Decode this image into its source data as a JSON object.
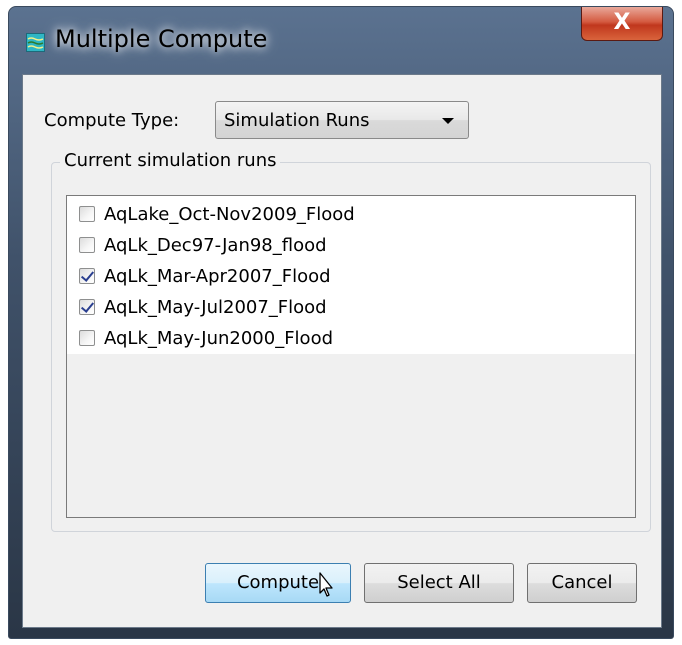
{
  "window": {
    "title": "Multiple Compute",
    "app_icon": "map-icon",
    "close_glyph": "X"
  },
  "compute_type": {
    "label": "Compute Type:",
    "selected": "Simulation Runs"
  },
  "runs_group": {
    "label": "Current simulation runs",
    "items": [
      {
        "label": "AqLake_Oct-Nov2009_Flood",
        "checked": false
      },
      {
        "label": "AqLk_Dec97-Jan98_flood",
        "checked": false
      },
      {
        "label": "AqLk_Mar-Apr2007_Flood",
        "checked": true
      },
      {
        "label": "AqLk_May-Jul2007_Flood",
        "checked": true
      },
      {
        "label": "AqLk_May-Jun2000_Flood",
        "checked": false
      }
    ]
  },
  "buttons": {
    "compute": "Compute",
    "select_all": "Select All",
    "cancel": "Cancel"
  },
  "colors": {
    "dialog_bg": "#f0f0f0",
    "default_button": "#bee6fd",
    "close_button": "#c0371d",
    "title_frame": "#40526a"
  }
}
